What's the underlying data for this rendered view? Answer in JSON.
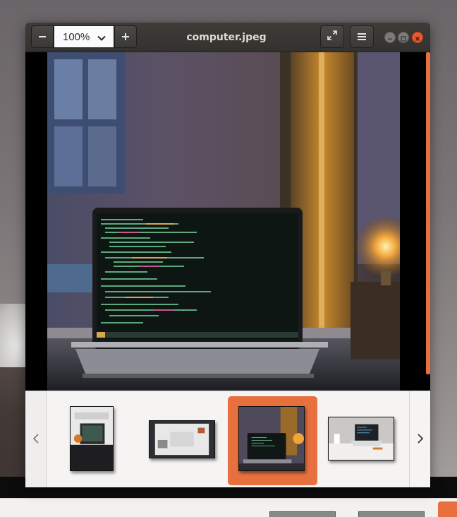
{
  "window": {
    "title": "computer.jpeg",
    "zoom": {
      "value": "100%"
    }
  },
  "colors": {
    "accent": "#e8703f",
    "titlebar": "#3a3936",
    "close": "#e9592d"
  },
  "icons": {
    "zoom_out": "minus-icon",
    "zoom_in": "plus-icon",
    "zoom_dropdown": "chevron-down-icon",
    "fullscreen": "fullscreen-icon",
    "menu": "hamburger-menu-icon",
    "minimize": "minimize-icon",
    "maximize": "maximize-icon",
    "close": "close-icon",
    "prev": "chevron-left-icon",
    "next": "chevron-right-icon"
  },
  "gallery": {
    "selected_index": 2,
    "thumbnails": [
      {
        "subject": "laptop-with-pumpkin"
      },
      {
        "subject": "desk-top-view"
      },
      {
        "subject": "laptop-with-lamp"
      },
      {
        "subject": "laptop-on-white-desk"
      }
    ]
  }
}
